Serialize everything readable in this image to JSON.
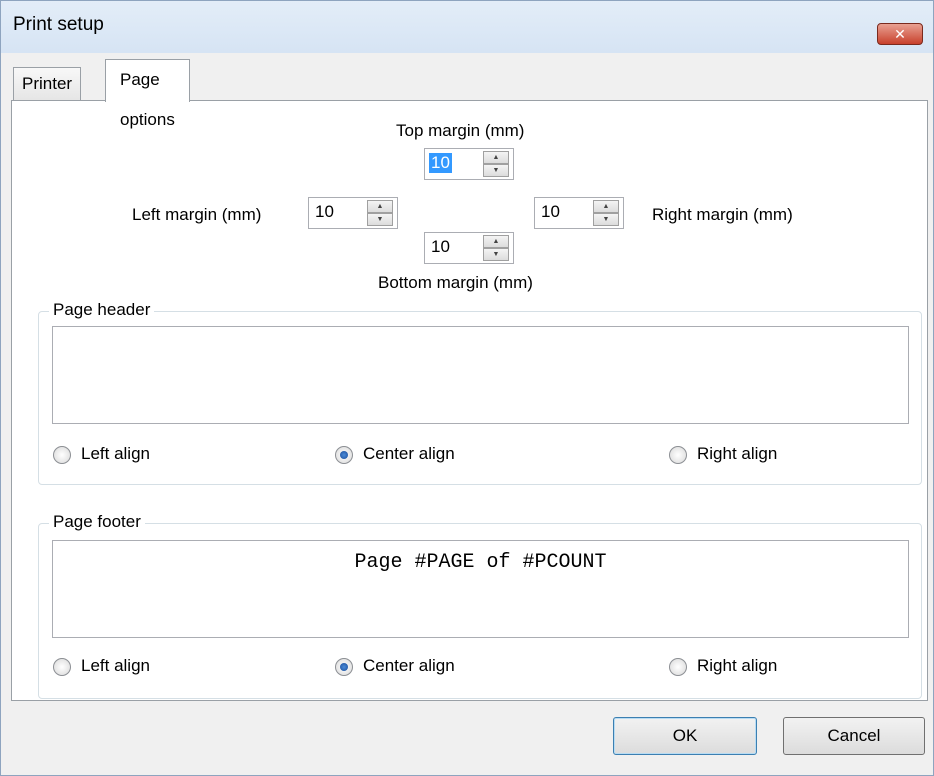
{
  "window": {
    "title": "Print setup",
    "close_glyph": "✕"
  },
  "tabs": [
    {
      "label": "Printer",
      "active": false
    },
    {
      "label": "Page options",
      "active": true
    }
  ],
  "margins": {
    "top": {
      "label": "Top margin (mm)",
      "value": "10"
    },
    "left": {
      "label": "Left margin (mm)",
      "value": "10"
    },
    "right": {
      "label": "Right margin (mm)",
      "value": "10"
    },
    "bottom": {
      "label": "Bottom margin (mm)",
      "value": "10"
    }
  },
  "page_header": {
    "title": "Page header",
    "text": "",
    "align_options": [
      "Left align",
      "Center align",
      "Right align"
    ],
    "selected": "Center align"
  },
  "page_footer": {
    "title": "Page footer",
    "text": "Page #PAGE of #PCOUNT",
    "align_options": [
      "Left align",
      "Center align",
      "Right align"
    ],
    "selected": "Center align"
  },
  "buttons": {
    "ok": "OK",
    "cancel": "Cancel"
  },
  "icons": {
    "spin_up": "▲",
    "spin_down": "▼"
  }
}
